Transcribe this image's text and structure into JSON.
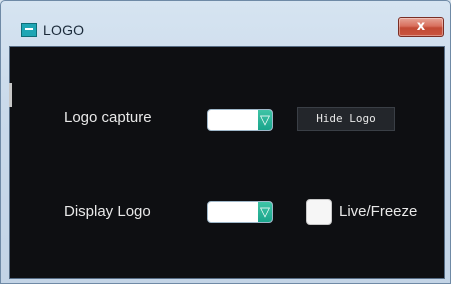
{
  "window": {
    "title": "LOGO",
    "close_symbol": "x"
  },
  "icons": {
    "app": "app-logo-icon",
    "close": "close-icon",
    "dropdown": "triangle-down-icon"
  },
  "colors": {
    "client_bg": "#0e0f12",
    "accent_teal": "#1aa58c",
    "close_red": "#c24a34"
  },
  "form": {
    "logo_capture": {
      "label": "Logo capture",
      "selected_value": "",
      "dropdown_arrow": "▽"
    },
    "hide_logo_button": {
      "label": "Hide Logo"
    },
    "display_logo": {
      "label": "Display Logo",
      "selected_value": "",
      "dropdown_arrow": "▽"
    },
    "live_freeze": {
      "label": "Live/Freeze",
      "checked": false
    }
  }
}
